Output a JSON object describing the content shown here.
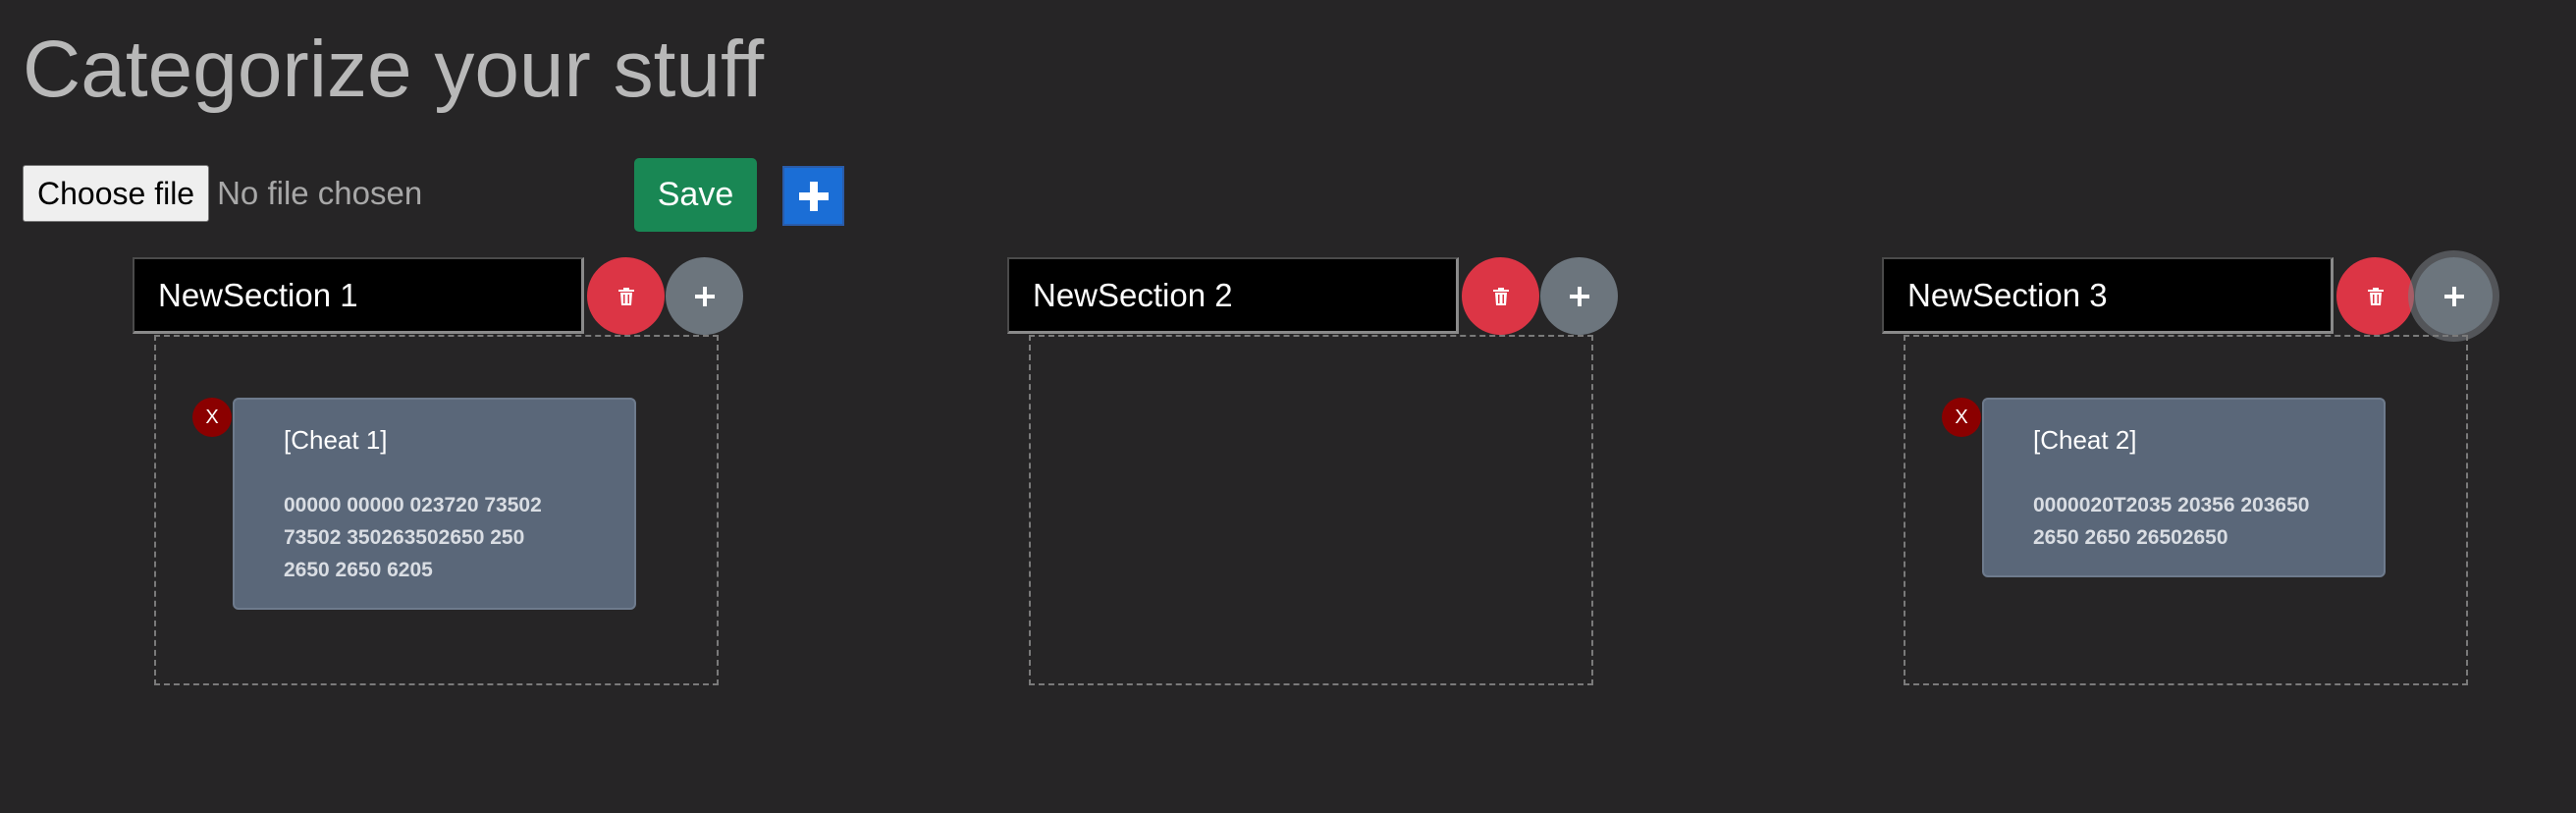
{
  "page": {
    "title": "Categorize your stuff"
  },
  "toolbar": {
    "choose_file_label": "Choose file",
    "file_status": "No file chosen",
    "save_label": "Save",
    "add_section_icon": "plus-icon"
  },
  "colors": {
    "background": "#262526",
    "save": "#198754",
    "add": "#1b6ed6",
    "delete": "#dc3545",
    "add_cheat": "#6c757d",
    "card": "#5a6779",
    "remove": "#8b0000"
  },
  "sections": [
    {
      "name": "NewSection 1",
      "cheats": [
        {
          "remove_label": "X",
          "title": "[Cheat 1]",
          "code_lines": [
            "00000 00000 023720 73502",
            "73502 350263502650 250",
            "2650 2650 6205"
          ]
        }
      ]
    },
    {
      "name": "NewSection 2",
      "cheats": []
    },
    {
      "name": "NewSection 3",
      "cheats": [
        {
          "remove_label": "X",
          "title": "[Cheat 2]",
          "code_lines": [
            "0000020T2035 20356 203650",
            "2650 2650 26502650"
          ]
        }
      ]
    }
  ]
}
